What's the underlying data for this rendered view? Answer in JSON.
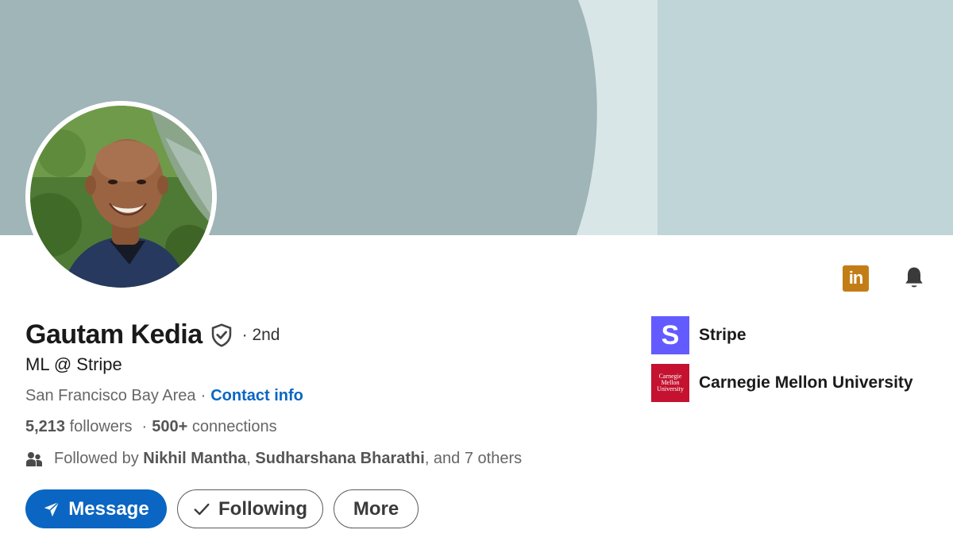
{
  "profile": {
    "name": "Gautam Kedia",
    "degree": "· 2nd",
    "headline": "ML @ Stripe",
    "location": "San Francisco Bay Area",
    "location_separator": "·",
    "contact_label": "Contact info",
    "followers_count": "5,213",
    "followers_label": "followers",
    "stats_separator": "·",
    "connections_count": "500+",
    "connections_label": "connections",
    "followed_by_prefix": "Followed by",
    "followed_by_1": "Nikhil Mantha",
    "followed_by_comma": ",",
    "followed_by_2": "Sudharshana Bharathi",
    "followed_by_suffix": ", and 7 others"
  },
  "actions": {
    "message_label": "Message",
    "following_label": "Following",
    "more_label": "More"
  },
  "organizations": [
    {
      "name": "Stripe",
      "logo_text": "S"
    },
    {
      "name": "Carnegie Mellon University",
      "logo_text_1": "Carnegie",
      "logo_text_2": "Mellon",
      "logo_text_3": "University"
    }
  ],
  "icons": {
    "linkedin_badge": "in",
    "verify": "shield-check-icon",
    "bell": "bell-icon",
    "people": "people-icon",
    "send": "send-icon",
    "check": "check-icon"
  },
  "colors": {
    "accent": "#0a66c2",
    "banner_dark": "#9fb5b7",
    "banner_light": "#bfd5d8",
    "linkedin_badge": "#c37d16",
    "stripe": "#635bff",
    "cmu": "#c41230"
  }
}
